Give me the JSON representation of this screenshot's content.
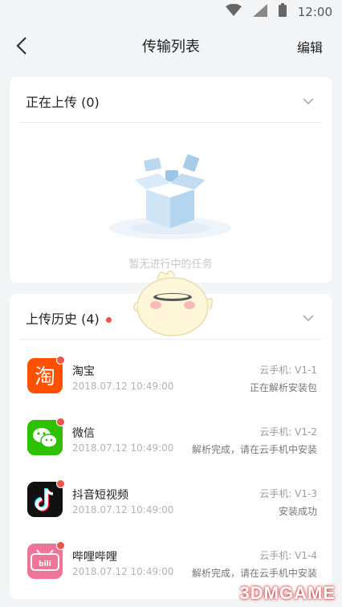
{
  "status_bar": {
    "time": "12:00",
    "icons": [
      "wifi-icon",
      "signal-icon",
      "battery-icon"
    ]
  },
  "header": {
    "title": "传输列表",
    "edit_label": "编辑"
  },
  "uploading": {
    "title": "正在上传 (0)",
    "empty_text": "暂无进行中的任务"
  },
  "history": {
    "title": "上传历史 (4)",
    "items": [
      {
        "name": "淘宝",
        "time": "2018.07.12  10:49:00",
        "device": "云手机: V1-1",
        "status": "正在解析安装包",
        "icon": "taobao-app-icon"
      },
      {
        "name": "微信",
        "time": "2018.07.12  10:49:00",
        "device": "云手机: V1-2",
        "status": "解析完成，请在云手机中安装",
        "icon": "wechat-app-icon"
      },
      {
        "name": "抖音短视频",
        "time": "2018.07.12  10:49:00",
        "device": "云手机: V1-3",
        "status": "安装成功",
        "icon": "douyin-app-icon"
      },
      {
        "name": "哔哩哔哩",
        "time": "2018.07.12  10:49:00",
        "device": "云手机: V1-4",
        "status": "解析完成，请在云手机中安装",
        "icon": "bilibili-app-icon"
      }
    ]
  },
  "watermark": "3DMGAME",
  "colors": {
    "badge": "#e8564d",
    "taobao": "#ff5000",
    "wechat": "#2dc100",
    "douyin": "#111111",
    "bilibili": "#f0739a"
  }
}
